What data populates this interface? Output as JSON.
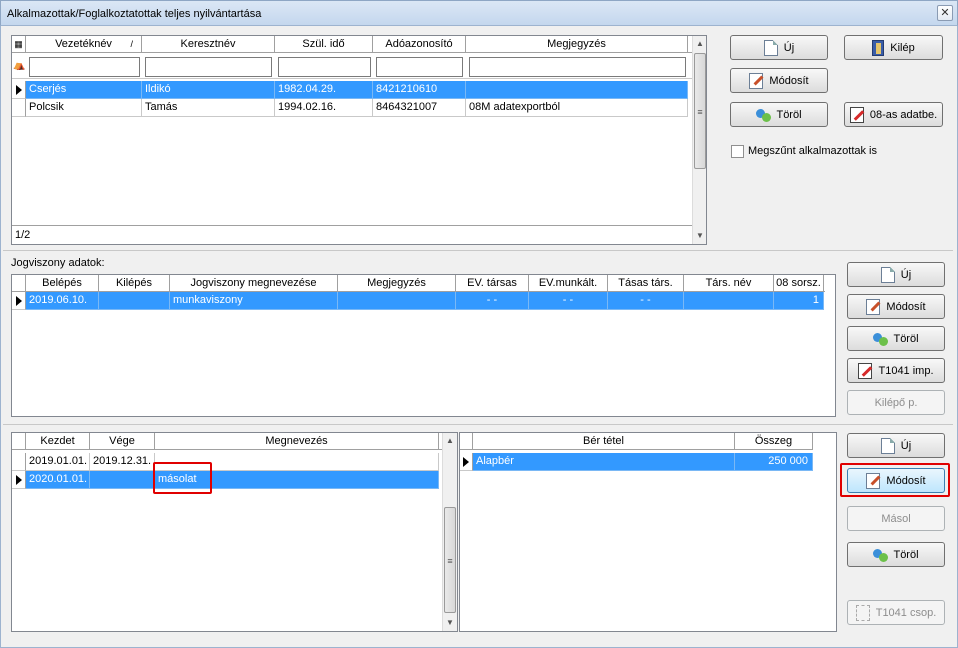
{
  "window": {
    "title": "Alkalmazottak/Foglalkoztatottak teljes nyilvántartása",
    "close_glyph": "✕"
  },
  "employees": {
    "columns": [
      "Vezetéknév",
      "Keresztnév",
      "Szül. idő",
      "Adóazonosító",
      "Megjegyzés"
    ],
    "sort_indicator": "/",
    "rows": [
      {
        "last": "Cserjés",
        "first": "Ildikó",
        "born": "1982.04.29.",
        "tax": "8421210610",
        "note": "",
        "selected": true
      },
      {
        "last": "Polcsik",
        "first": "Tamás",
        "born": "1994.02.16.",
        "tax": "8464321007",
        "note": "08M adatexportból",
        "selected": false
      }
    ],
    "record_counter": "1/2",
    "buttons": {
      "new": "Új",
      "exit": "Kilép",
      "modify": "Módosít",
      "delete": "Töröl",
      "import08": "08-as adatbe."
    },
    "checkbox_label": "Megszűnt alkalmazottak is"
  },
  "legal": {
    "label": "Jogviszony adatok:",
    "columns": [
      "Belépés",
      "Kilépés",
      "Jogviszony megnevezése",
      "Megjegyzés",
      "EV. társas",
      "EV.munkált.",
      "Tásas társ.",
      "Társ. név",
      "08 sorsz."
    ],
    "rows": [
      {
        "entry": "2019.06.10.",
        "exit": "",
        "name": "munkaviszony",
        "note": "",
        "ev_tarsas": "- -",
        "ev_munkalt": "- -",
        "tasas": "- -",
        "tars_nev": "",
        "sorsz": "1",
        "selected": true
      }
    ],
    "buttons": {
      "new": "Új",
      "modify": "Módosít",
      "delete": "Töröl",
      "import": "T1041 imp.",
      "leaver": "Kilépő p."
    }
  },
  "periods": {
    "columns": [
      "Kezdet",
      "Vége",
      "Megnevezés"
    ],
    "rows": [
      {
        "start": "2019.01.01.",
        "end": "2019.12.31.",
        "name": "",
        "selected": false
      },
      {
        "start": "2020.01.01.",
        "end": "",
        "name": "másolat",
        "selected": true
      }
    ]
  },
  "salary": {
    "columns": [
      "Bér tétel",
      "Összeg"
    ],
    "rows": [
      {
        "item": "Alapbér",
        "amount": "250 000",
        "selected": true
      }
    ],
    "buttons": {
      "new": "Új",
      "modify": "Módosít",
      "copy": "Másol",
      "delete": "Töröl",
      "group": "T1041 csop."
    }
  },
  "colors": {
    "selection": "#3399ff",
    "highlight": "#e00000"
  }
}
